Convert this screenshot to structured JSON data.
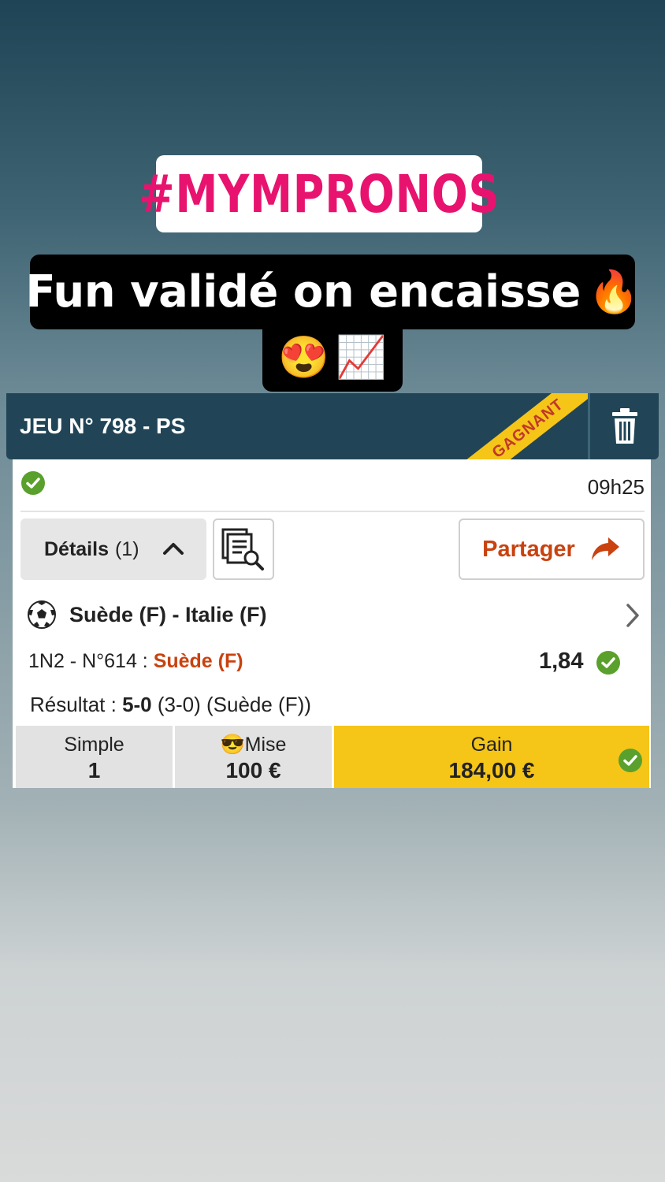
{
  "story": {
    "hashtag": "#MYMPRONOS",
    "caption": "Fun validé on encaisse",
    "caption_emoji_1": "🔥",
    "caption_emoji_2": "😍",
    "caption_emoji_3": "📈"
  },
  "bet_card": {
    "title": "JEU N° 798 - PS",
    "ribbon": "GAGNANT",
    "time": "09h25",
    "details_label": "Détails",
    "details_count": "(1)",
    "share_label": "Partager",
    "match": "Suède (F) - Italie (F)",
    "bet_market": "1N2 - N°614 : ",
    "bet_pick": "Suède (F)",
    "odds": "1,84",
    "result_prefix": "Résultat : ",
    "result_score": "5-0",
    "result_suffix": " (3-0) (Suède (F))",
    "summary": {
      "type_label": "Simple",
      "type_value": "1",
      "stake_emoji": "😎",
      "stake_label": "Mise",
      "stake_value": "100 €",
      "gain_label": "Gain",
      "gain_value": "184,00 €"
    }
  },
  "colors": {
    "header": "#214557",
    "accent_orange": "#c9420f",
    "gain_yellow": "#f5c518",
    "hashtag_pink": "#e8136f",
    "success_green": "#5aa02c"
  }
}
